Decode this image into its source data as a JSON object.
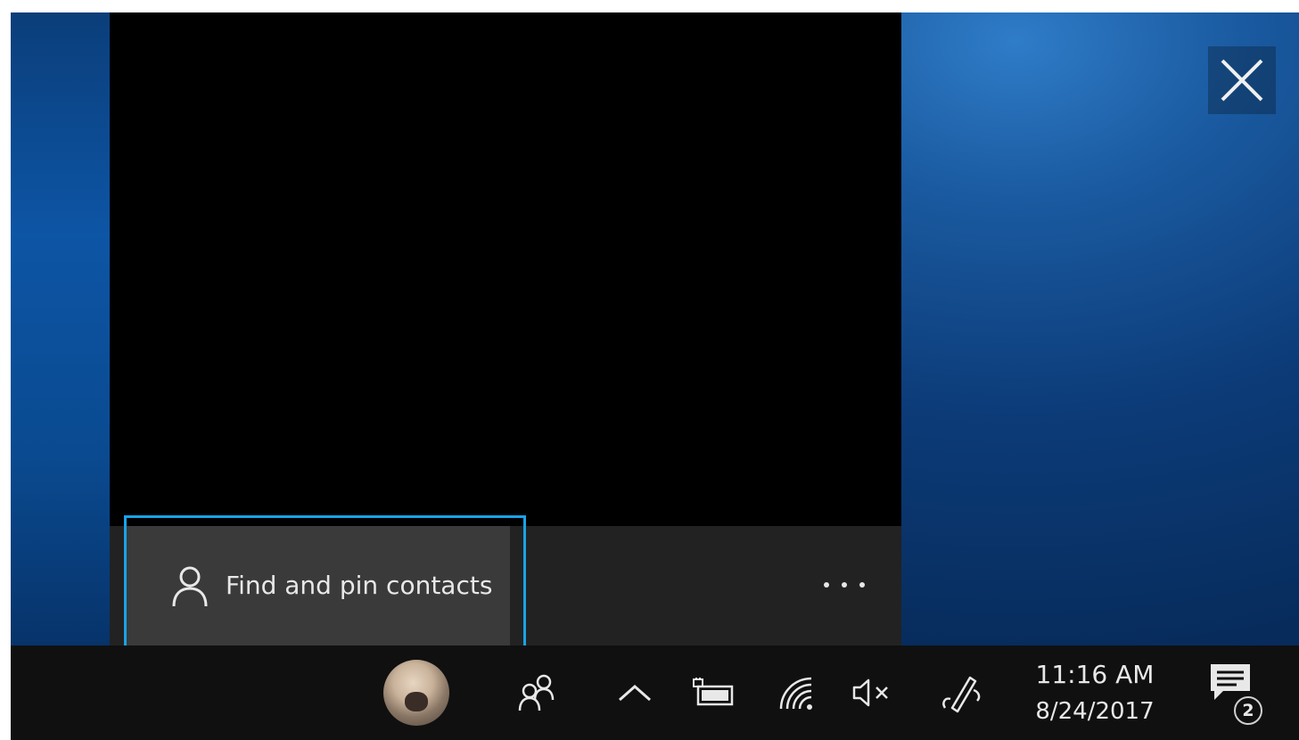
{
  "people_flyout": {
    "find_pin_label": "Find and pin contacts",
    "more_label": "…"
  },
  "window_controls": {
    "close_icon": "close-icon"
  },
  "taskbar": {
    "avatar_icon": "contact-avatar",
    "people_icon": "people-icon",
    "show_hidden_icons_icon": "chevron-up-icon",
    "battery_icon": "battery-icon",
    "wifi_icon": "wifi-icon",
    "volume_icon": "volume-muted-icon",
    "pen_icon": "windows-ink-icon",
    "clock": {
      "time": "11:16 AM",
      "date": "8/24/2017"
    },
    "action_center": {
      "icon": "action-center-icon",
      "badge_count": "2"
    }
  },
  "colors": {
    "highlight": "#1aa3e8",
    "flyout_bg": "#000000",
    "flyout_bar_bg": "#222222",
    "button_bg": "#3a3a3a",
    "taskbar_bg": "#101010"
  }
}
